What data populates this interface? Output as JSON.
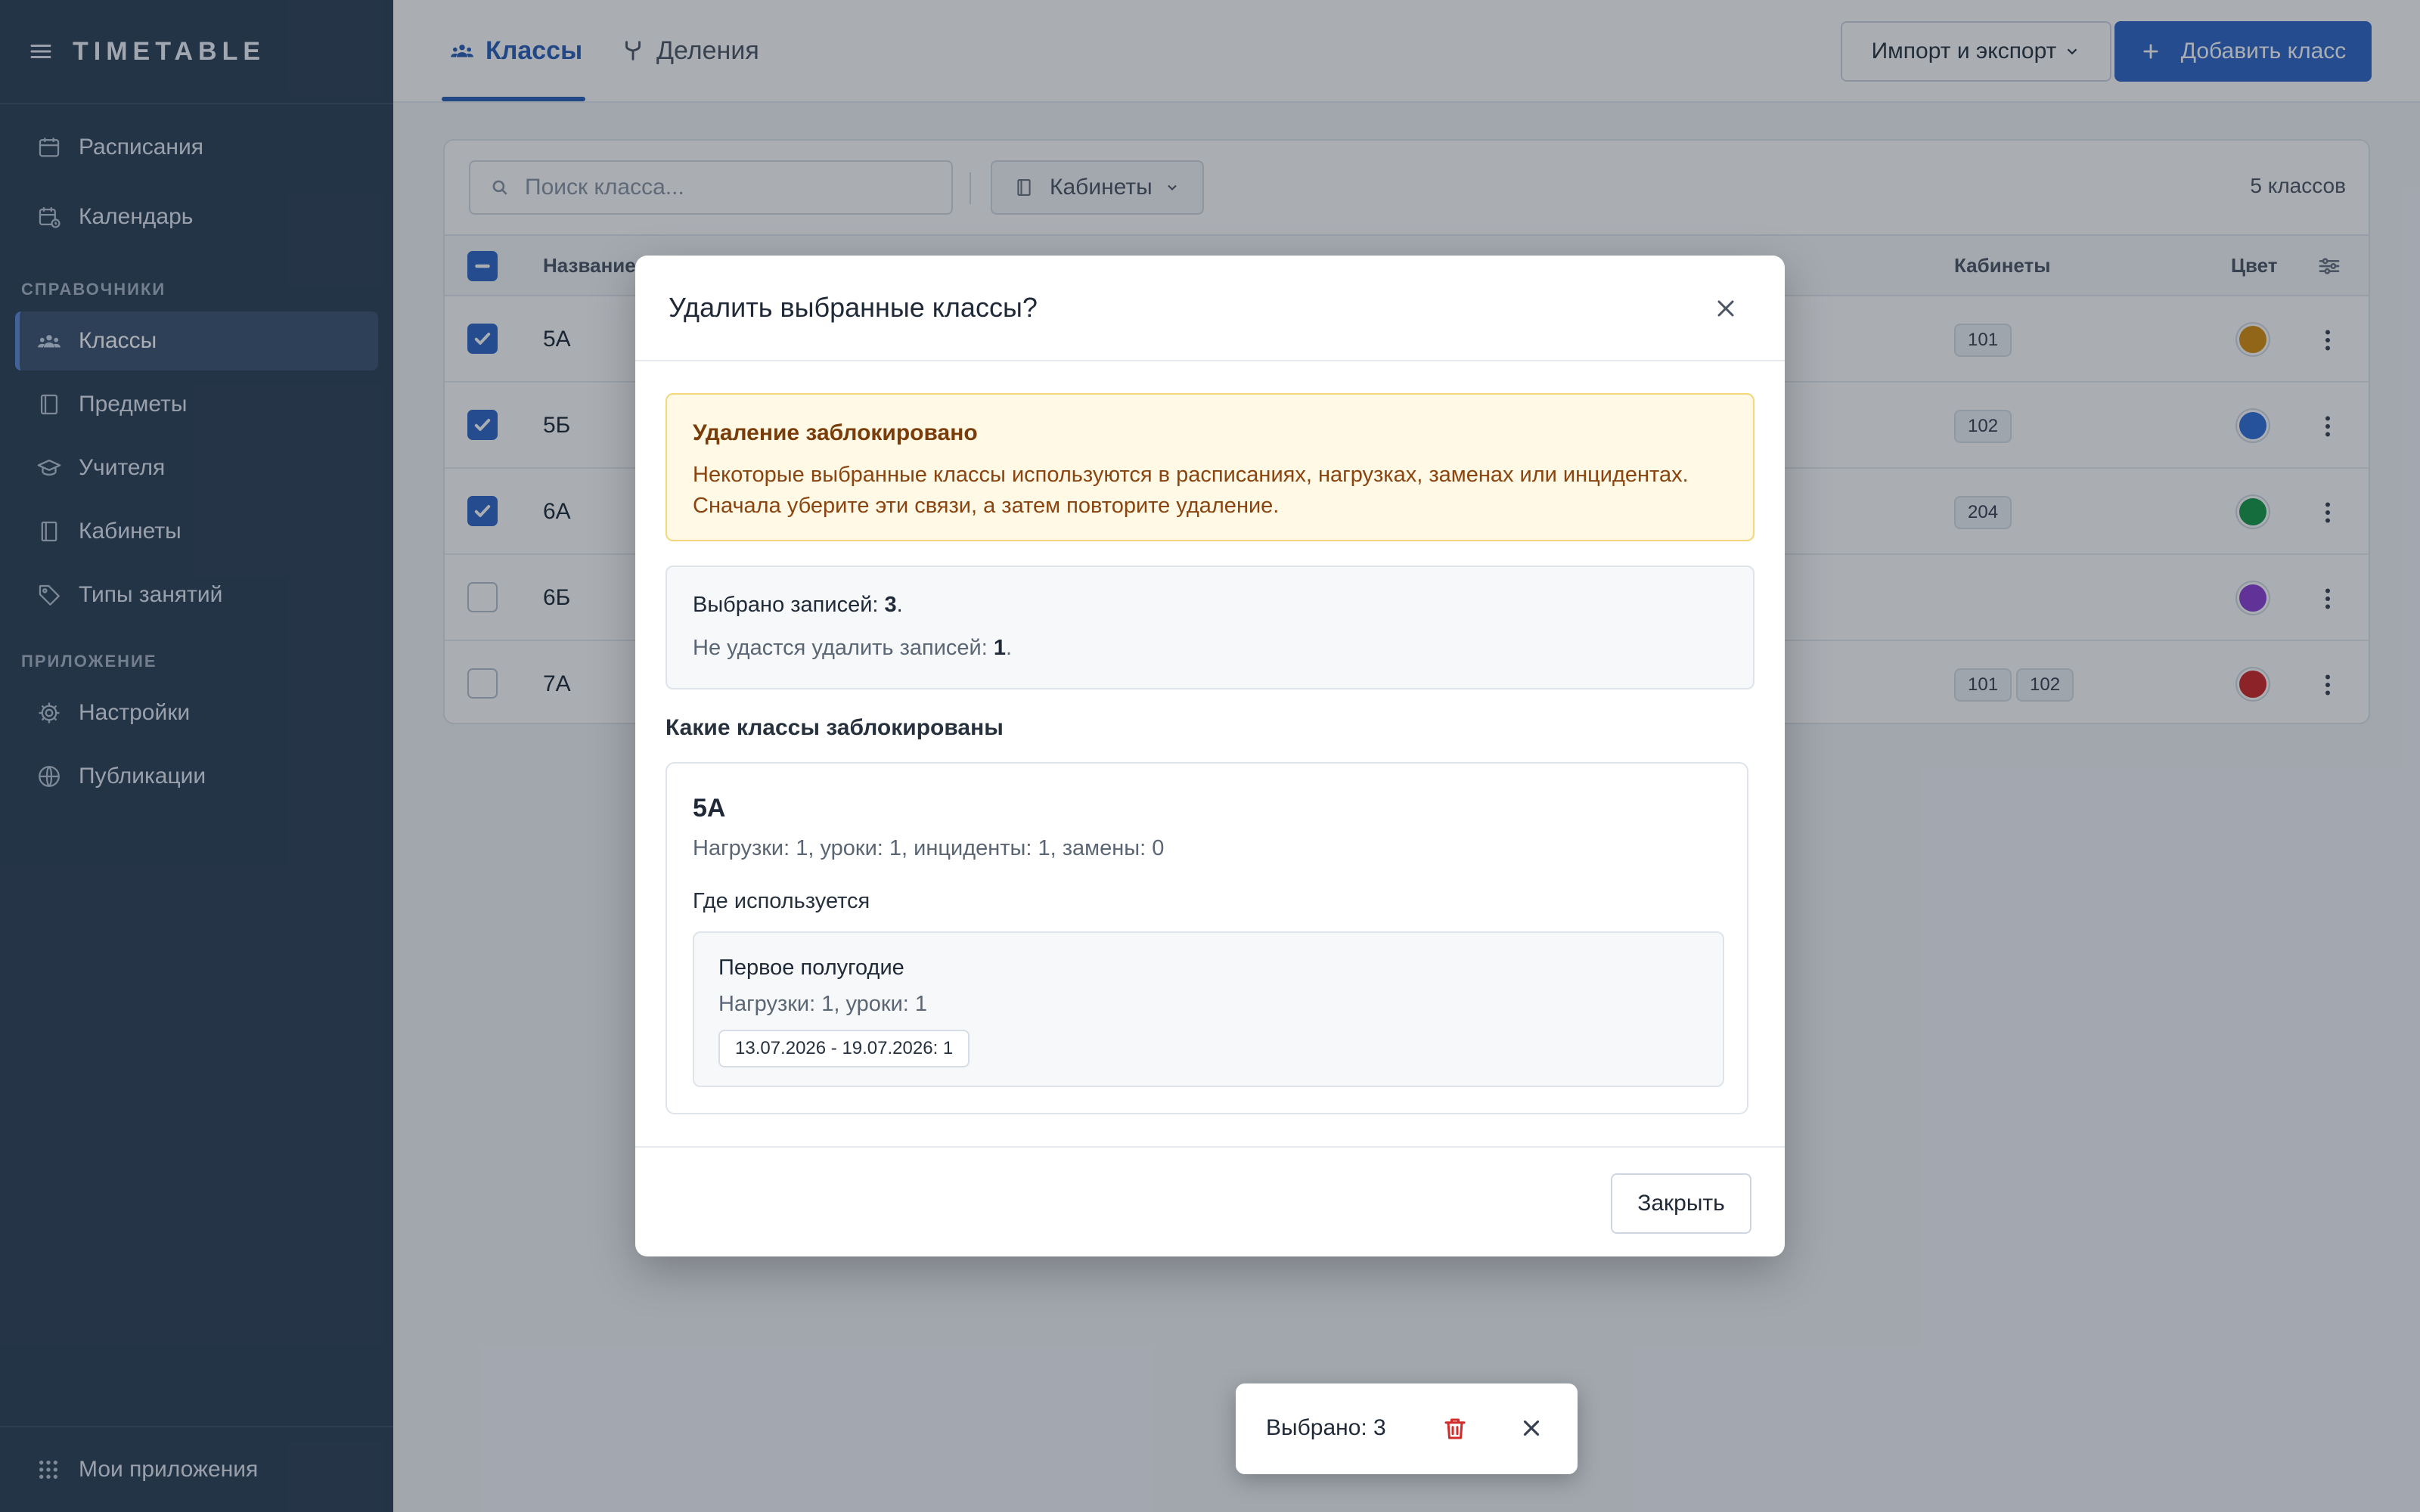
{
  "app": {
    "brand": "TIMETABLE"
  },
  "sidebar": {
    "items": [
      {
        "label": "Расписания",
        "icon": "calendar-icon"
      },
      {
        "label": "Календарь",
        "icon": "calendar-clock-icon"
      }
    ],
    "sections": [
      {
        "title": "СПРАВОЧНИКИ",
        "items": [
          {
            "label": "Классы",
            "icon": "users-icon",
            "active": true
          },
          {
            "label": "Предметы",
            "icon": "book-icon"
          },
          {
            "label": "Учителя",
            "icon": "graduation-cap-icon"
          },
          {
            "label": "Кабинеты",
            "icon": "door-icon"
          },
          {
            "label": "Типы занятий",
            "icon": "tag-icon"
          }
        ]
      },
      {
        "title": "ПРИЛОЖЕНИЕ",
        "items": [
          {
            "label": "Настройки",
            "icon": "gear-icon"
          },
          {
            "label": "Публикации",
            "icon": "globe-icon"
          }
        ]
      }
    ],
    "footer": {
      "label": "Мои приложения",
      "icon": "grid-icon"
    }
  },
  "header": {
    "tabs": [
      {
        "label": "Классы",
        "icon": "users-icon",
        "active": true
      },
      {
        "label": "Деления",
        "icon": "split-icon"
      }
    ],
    "import_export_label": "Импорт и экспорт",
    "add_label": "Добавить класс"
  },
  "toolbar": {
    "search_placeholder": "Поиск класса...",
    "filter_label": "Кабинеты",
    "count_label": "5 классов"
  },
  "table": {
    "columns": {
      "name": "Название",
      "rooms": "Кабинеты",
      "color": "Цвет"
    },
    "rows": [
      {
        "name": "5А",
        "checked": true,
        "rooms": [
          "101"
        ],
        "color": "#d98f0e"
      },
      {
        "name": "5Б",
        "checked": true,
        "rooms": [
          "102"
        ],
        "color": "#2f6fd9"
      },
      {
        "name": "6А",
        "checked": true,
        "rooms": [
          "204"
        ],
        "color": "#169a47"
      },
      {
        "name": "6Б",
        "checked": false,
        "rooms": [],
        "color": "#8d3fd6"
      },
      {
        "name": "7А",
        "checked": false,
        "rooms": [
          "101",
          "102"
        ],
        "color": "#d02727"
      }
    ]
  },
  "modal": {
    "title": "Удалить выбранные классы?",
    "warning": {
      "title": "Удаление заблокировано",
      "line1": "Некоторые выбранные классы используются в расписаниях, нагрузках, заменах или инцидентах.",
      "line2": "Сначала уберите эти связи, а затем повторите удаление."
    },
    "summary": {
      "selected_prefix": "Выбрано записей: ",
      "selected_count": "3",
      "blocked_prefix": "Не удастся удалить записей: ",
      "blocked_count": "1",
      "suffix": "."
    },
    "blocked_heading": "Какие классы заблокированы",
    "blocked": [
      {
        "name": "5А",
        "stats": "Нагрузки: 1, уроки: 1, инциденты: 1, замены: 0",
        "where_label": "Где используется",
        "usages": [
          {
            "title": "Первое полугодие",
            "stats": "Нагрузки: 1, уроки: 1",
            "range": "13.07.2026 - 19.07.2026: 1"
          }
        ]
      }
    ],
    "close_label": "Закрыть"
  },
  "selection_toast": {
    "label": "Выбрано: 3"
  },
  "colors": {
    "accent": "#2f66c7",
    "sidebar_bg": "#2e4056",
    "warning_bg": "#fff9e5",
    "warning_text": "#7a3d09",
    "danger": "#d12c2c"
  }
}
